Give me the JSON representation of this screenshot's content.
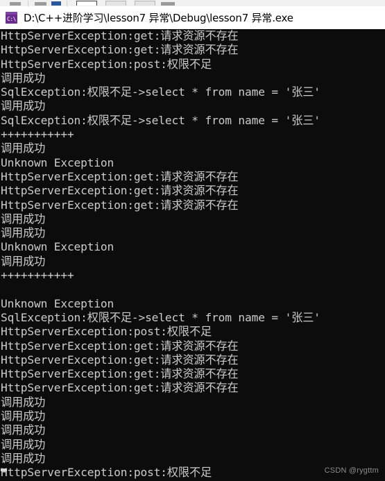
{
  "window": {
    "title": "D:\\C++进阶学习\\lesson7 异常\\Debug\\lesson7 异常.exe",
    "icon_name": "console-app-icon",
    "icon_glyph": "C:\\",
    "titlebar_bg": "#ffffff",
    "title_color": "#000000",
    "icon_color": "#6a2d8f"
  },
  "console": {
    "background": "#0c0c0c",
    "foreground": "#cccccc",
    "cursor_visible": true,
    "lines": [
      "HttpServerException:get:请求资源不存在",
      "HttpServerException:get:请求资源不存在",
      "HttpServerException:post:权限不足",
      "调用成功",
      "SqlException:权限不足->select * from name = '张三'",
      "调用成功",
      "SqlException:权限不足->select * from name = '张三'",
      "+++++++++++",
      "调用成功",
      "Unknown Exception",
      "HttpServerException:get:请求资源不存在",
      "HttpServerException:get:请求资源不存在",
      "HttpServerException:get:请求资源不存在",
      "调用成功",
      "调用成功",
      "Unknown Exception",
      "调用成功",
      "+++++++++++",
      "",
      "Unknown Exception",
      "SqlException:权限不足->select * from name = '张三'",
      "HttpServerException:post:权限不足",
      "HttpServerException:get:请求资源不存在",
      "HttpServerException:get:请求资源不存在",
      "HttpServerException:get:请求资源不存在",
      "HttpServerException:get:请求资源不存在",
      "调用成功",
      "调用成功",
      "调用成功",
      "调用成功",
      "调用成功",
      "HttpServerException:post:权限不足"
    ]
  },
  "watermark": {
    "text": "CSDN @rygttm",
    "color": "#8e8e8e"
  }
}
